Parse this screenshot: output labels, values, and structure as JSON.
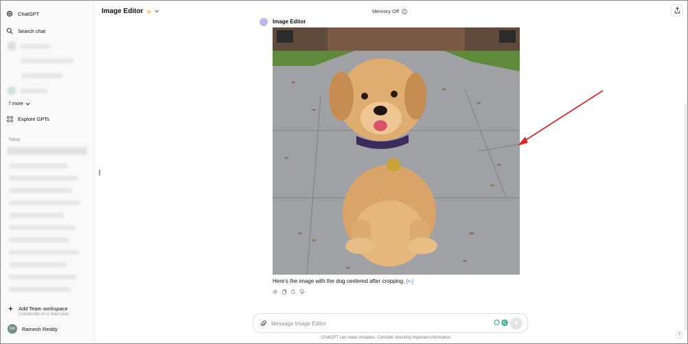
{
  "sidebar": {
    "app_name": "ChatGPT",
    "search_label": "Search chat",
    "more_label": "7 more",
    "explore_label": "Explore GPTs",
    "today_label": "Today",
    "team_title": "Add Team workspace",
    "team_subtitle": "Collaborate on a Team plan",
    "user_initials": "RA",
    "user_name": "Ramesh Reddy"
  },
  "header": {
    "model_title": "Image Editor",
    "memory_status": "Memory Off"
  },
  "message": {
    "bot_name": "Image Editor",
    "text": "Here's the image with the dog centered after cropping.",
    "source_marker": "[>-]"
  },
  "composer": {
    "placeholder": "Message Image Editor"
  },
  "footer": {
    "note": "ChatGPT can make mistakes. Consider checking important information.",
    "help": "?"
  },
  "colors": {
    "annotation_arrow": "#d62828",
    "sidebar_bg": "#f9f9f9",
    "link": "#3a6ed8"
  },
  "icons": {
    "logo": "openai-logo-icon",
    "search": "search-icon",
    "explore": "grid-icon",
    "share": "share-icon",
    "attach": "paperclip-icon",
    "send": "arrow-up-icon"
  }
}
